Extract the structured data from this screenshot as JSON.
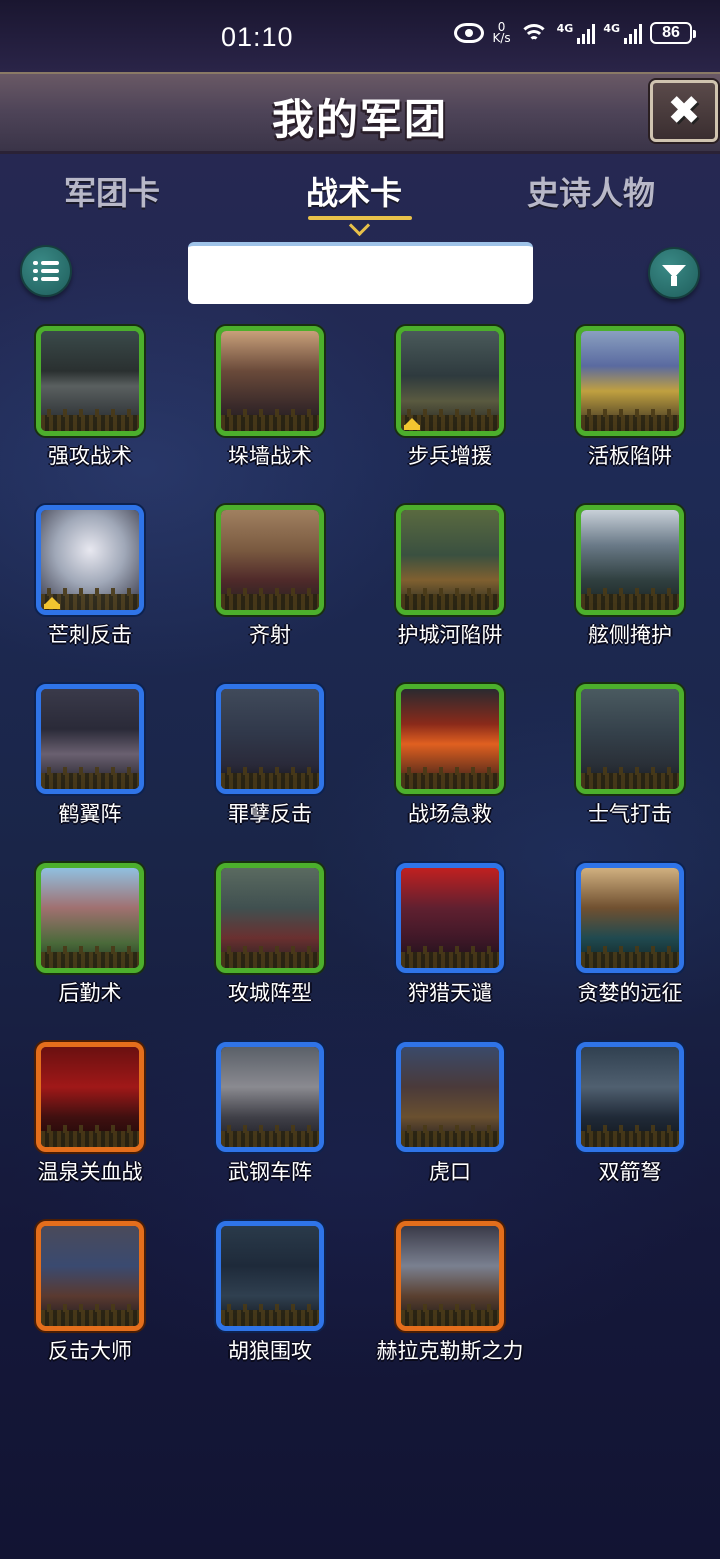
{
  "status": {
    "time": "01:10",
    "speed_value": "0",
    "speed_unit": "K/s",
    "net1": "4G",
    "net2": "4G",
    "battery": "86"
  },
  "header": {
    "title": "我的军团",
    "close_label": "✖"
  },
  "tabs": [
    {
      "label": "军团卡",
      "active": false
    },
    {
      "label": "战术卡",
      "active": true
    },
    {
      "label": "史诗人物",
      "active": false
    }
  ],
  "search": {
    "value": "",
    "placeholder": ""
  },
  "colors": {
    "green_frame": "#4caf2c",
    "blue_frame": "#2f74e8",
    "orange_frame": "#e46e1c",
    "tab_accent": "#e8c14a",
    "round_button": "#2a7370"
  },
  "cards": [
    {
      "label": "强攻战术",
      "rarity": "green",
      "crown": false
    },
    {
      "label": "垛墙战术",
      "rarity": "green",
      "crown": false
    },
    {
      "label": "步兵增援",
      "rarity": "green",
      "crown": true
    },
    {
      "label": "活板陷阱",
      "rarity": "green",
      "crown": false
    },
    {
      "label": "芒刺反击",
      "rarity": "blue",
      "crown": true
    },
    {
      "label": "齐射",
      "rarity": "green",
      "crown": false
    },
    {
      "label": "护城河陷阱",
      "rarity": "green",
      "crown": false
    },
    {
      "label": "舷侧掩护",
      "rarity": "green",
      "crown": false
    },
    {
      "label": "鹤翼阵",
      "rarity": "blue",
      "crown": false
    },
    {
      "label": "罪孽反击",
      "rarity": "blue",
      "crown": false
    },
    {
      "label": "战场急救",
      "rarity": "green",
      "crown": false
    },
    {
      "label": "士气打击",
      "rarity": "green",
      "crown": false
    },
    {
      "label": "后勤术",
      "rarity": "green",
      "crown": false
    },
    {
      "label": "攻城阵型",
      "rarity": "green",
      "crown": false
    },
    {
      "label": "狩猎天谴",
      "rarity": "blue",
      "crown": false
    },
    {
      "label": "贪婪的远征",
      "rarity": "blue",
      "crown": false
    },
    {
      "label": "温泉关血战",
      "rarity": "orange",
      "crown": false
    },
    {
      "label": "武钢车阵",
      "rarity": "blue",
      "crown": false
    },
    {
      "label": "虎口",
      "rarity": "blue",
      "crown": false
    },
    {
      "label": "双箭弩",
      "rarity": "blue",
      "crown": false
    },
    {
      "label": "反击大师",
      "rarity": "orange",
      "crown": false
    },
    {
      "label": "胡狼围攻",
      "rarity": "blue",
      "crown": false
    },
    {
      "label": "赫拉克勒斯之力",
      "rarity": "orange",
      "crown": false
    }
  ]
}
